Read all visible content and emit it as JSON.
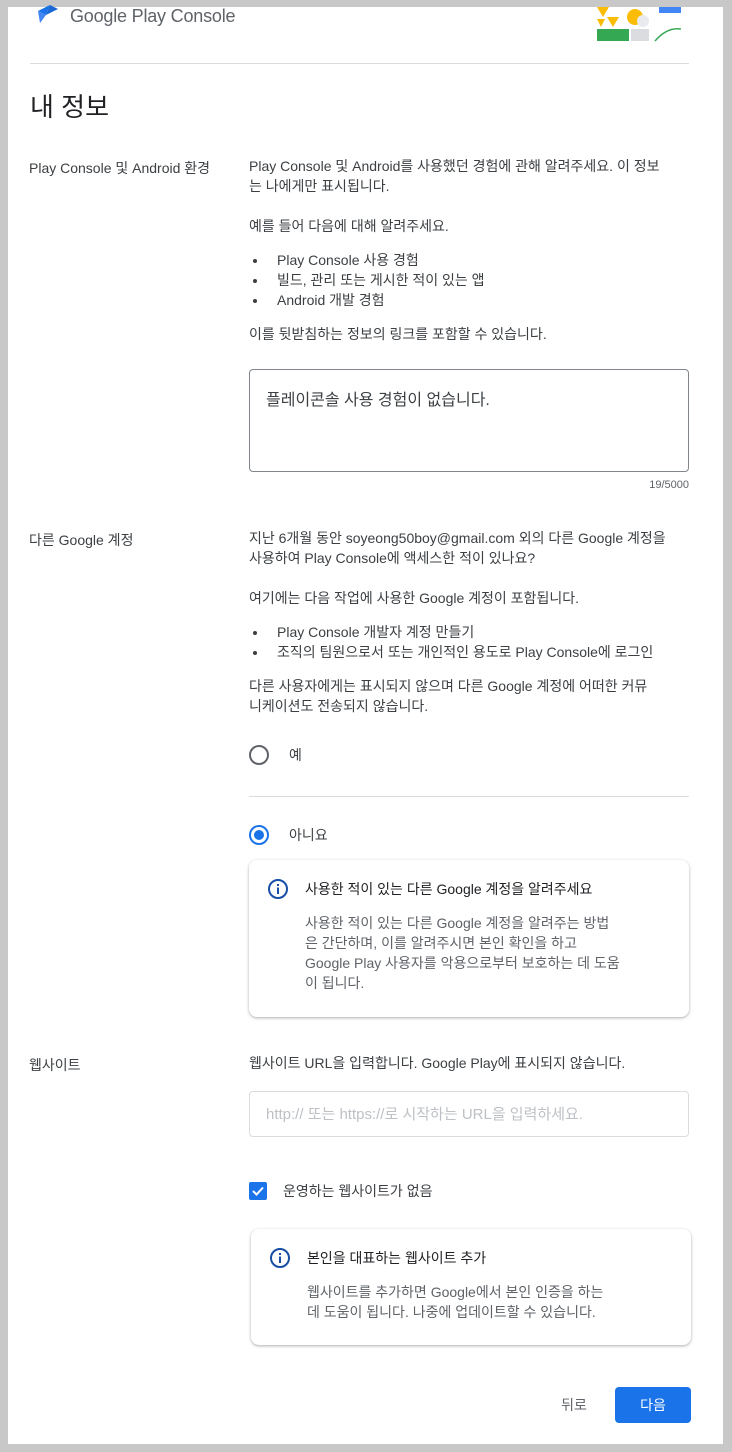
{
  "header": {
    "logo_text": "Google Play Console"
  },
  "page_title": "내 정보",
  "experience": {
    "label": "Play Console 및 Android 환경",
    "intro_line1": "Play Console 및 Android를 사용했던 경험에 관해 알려주세요. 이 정보",
    "intro_line2": "는 나에게만 표시됩니다.",
    "example_heading": "예를 들어 다음에 대해 알려주세요.",
    "bullets": [
      "Play Console 사용 경험",
      "빌드, 관리 또는 게시한 적이 있는 앱",
      "Android 개발 경험"
    ],
    "link_note": "이를 뒷받침하는 정보의 링크를 포함할 수 있습니다.",
    "textarea_value": "플레이콘솔 사용 경험이 없습니다.",
    "counter": "19/5000"
  },
  "other_account": {
    "label": "다른 Google 계정",
    "question_line1": "지난 6개월 동안 soyeong50boy@gmail.com 외의 다른 Google 계정을",
    "question_line2": "사용하여 Play Console에 액세스한 적이 있나요?",
    "includes_heading": "여기에는 다음 작업에 사용한 Google 계정이 포함됩니다.",
    "bullets": [
      "Play Console 개발자 계정 만들기",
      "조직의 팀원으로서 또는 개인적인 용도로 Play Console에 로그인"
    ],
    "privacy_line1": "다른 사용자에게는 표시되지 않으며 다른 Google 계정에 어떠한 커뮤",
    "privacy_line2": "니케이션도 전송되지 않습니다.",
    "option_yes": "예",
    "option_no": "아니요",
    "info_card": {
      "title": "사용한 적이 있는 다른 Google 계정을 알려주세요",
      "line1": "사용한 적이 있는 다른 Google 계정을 알려주는 방법",
      "line2": "은 간단하며, 이를 알려주시면 본인 확인을 하고",
      "line3": "Google Play 사용자를 악용으로부터 보호하는 데 도움",
      "line4": "이 됩니다."
    }
  },
  "website": {
    "label": "웹사이트",
    "description": "웹사이트 URL을 입력합니다. Google Play에 표시되지 않습니다.",
    "placeholder": "http:// 또는 https://로 시작하는 URL을 입력하세요.",
    "checkbox_label": "운영하는 웹사이트가 없음",
    "info_card": {
      "title": "본인을 대표하는 웹사이트 추가",
      "line1": "웹사이트를 추가하면 Google에서 본인 인증을 하는",
      "line2": "데 도움이 됩니다. 나중에 업데이트할 수 있습니다."
    }
  },
  "footer": {
    "back_label": "뒤로",
    "next_label": "다음"
  },
  "colors": {
    "accent": "#1a73e8",
    "info_icon": "#174ea6"
  }
}
